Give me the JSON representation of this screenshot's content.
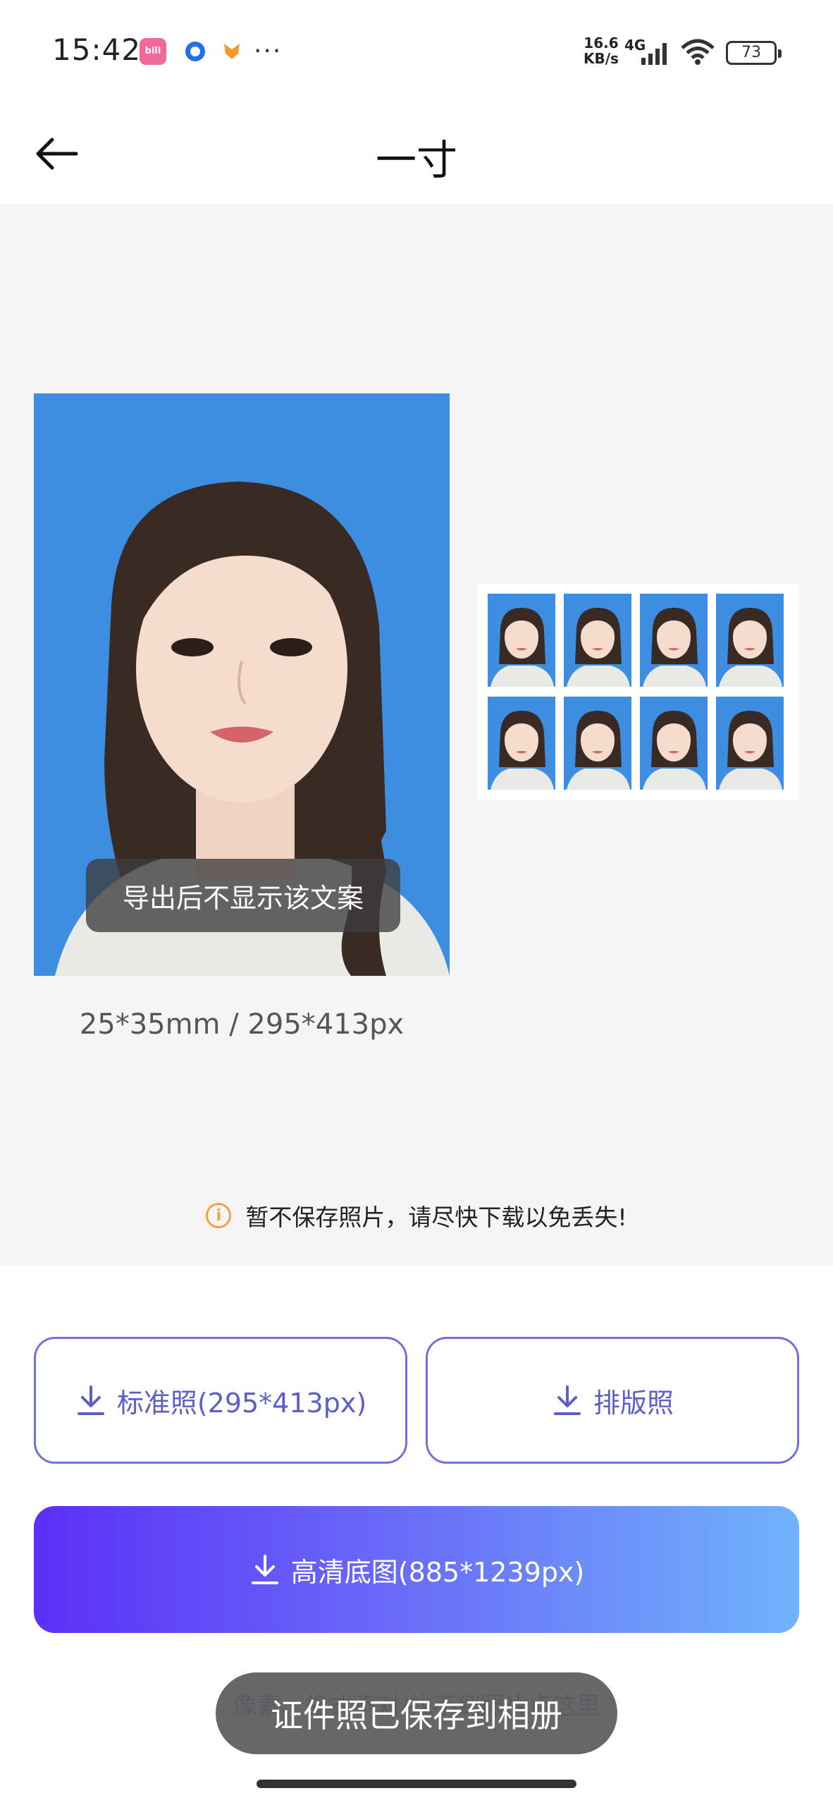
{
  "status_bar": {
    "time": "15:42",
    "net_speed_value": "16.6",
    "net_speed_unit": "KB/s",
    "network": "4G",
    "battery": "73",
    "app_icons": [
      "bilibili-icon",
      "blue-ring-app-icon",
      "fox-app-icon"
    ]
  },
  "nav": {
    "title": "一寸"
  },
  "preview": {
    "watermark_text": "导出后不显示该文案",
    "size_text": "25*35mm / 295*413px",
    "background_color": "#3d8ee0",
    "layout_sheet_count": 8
  },
  "notice": {
    "text": "暂不保存照片，请尽快下载以免丢失!"
  },
  "buttons": {
    "standard_label": "标准照(295*413px)",
    "layout_label": "排版照",
    "hd_label": "高清底图(885*1239px)"
  },
  "bottom_link": "像素、格式不对/找不到照片点这里",
  "toast": "证件照已保存到相册",
  "colors": {
    "accent": "#5d5fc8",
    "gradient_start": "#5b2ff7",
    "gradient_end": "#6fb3fb",
    "info": "#f2a04a"
  }
}
